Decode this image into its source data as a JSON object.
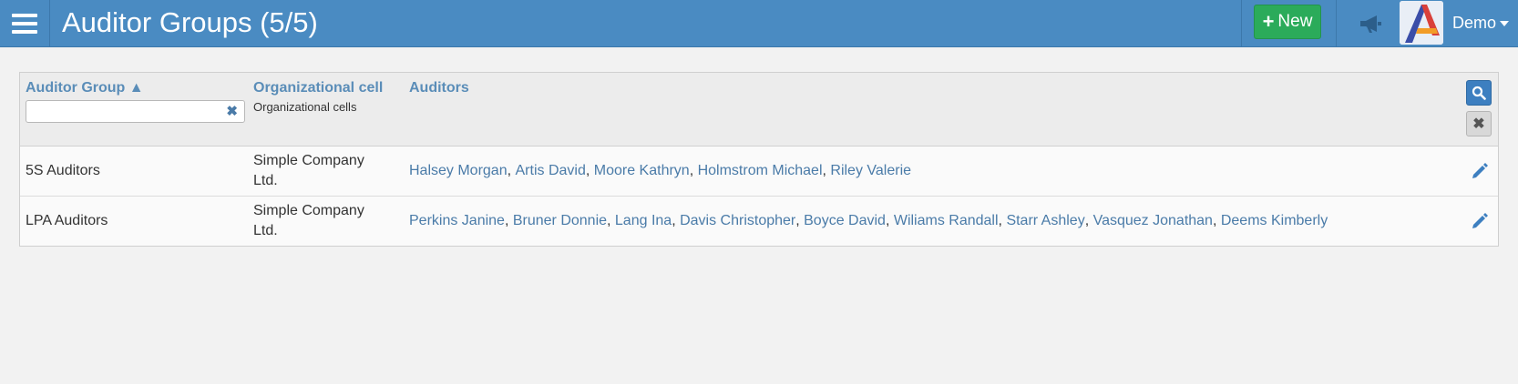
{
  "header": {
    "title": "Auditor Groups (5/5)",
    "new_button": {
      "icon": "plus-icon",
      "label": "New"
    },
    "announcement_icon": "megaphone-icon",
    "avatar_icon": "app-logo",
    "user_label": "Demo"
  },
  "table": {
    "columns": {
      "group": {
        "title": "Auditor Group ▲",
        "filter_value": "",
        "filter_placeholder": ""
      },
      "org": {
        "title": "Organizational cell",
        "subtitle": "Organizational cells"
      },
      "auditors": {
        "title": "Auditors"
      }
    },
    "rows": [
      {
        "name": "5S Auditors",
        "org_cell": "Simple Company Ltd.",
        "auditors": [
          "Halsey Morgan",
          "Artis David",
          "Moore Kathryn",
          "Holmstrom Michael",
          "Riley Valerie"
        ]
      },
      {
        "name": "LPA Auditors",
        "org_cell": "Simple Company Ltd.",
        "auditors": [
          "Perkins Janine",
          "Bruner Donnie",
          "Lang Ina",
          "Davis Christopher",
          "Boyce David",
          "Wiliams Randall",
          "Starr Ashley",
          "Vasquez Jonathan",
          "Deems Kimberly"
        ]
      }
    ]
  },
  "colors": {
    "header_bg": "#4a8bc2",
    "new_button_bg": "#2bab5a",
    "link": "#4a7ba8",
    "column_header": "#5a8db8"
  }
}
